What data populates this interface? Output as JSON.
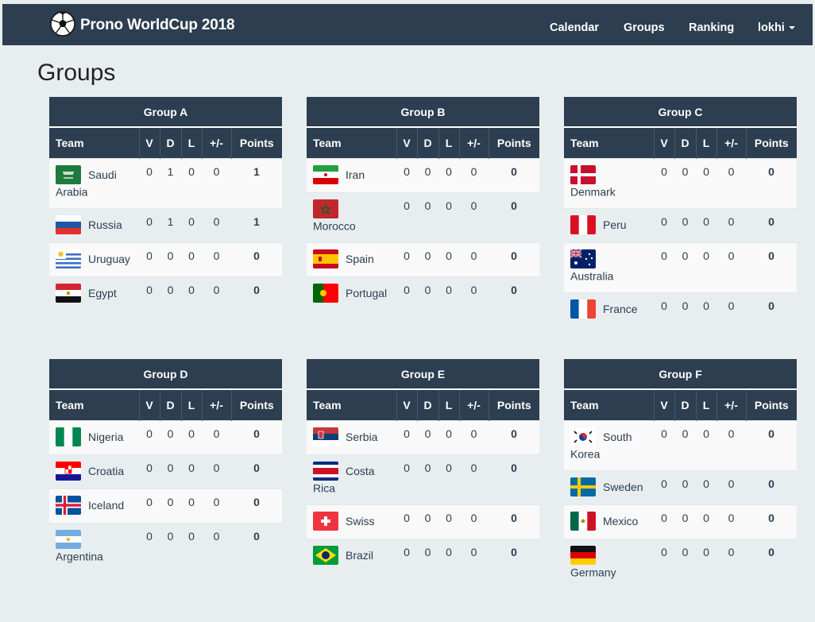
{
  "navbar": {
    "brand": "Prono WorldCup 2018",
    "links": [
      "Calendar",
      "Groups",
      "Ranking"
    ],
    "user": "lokhi"
  },
  "page": {
    "title": "Groups"
  },
  "columns": {
    "team": "Team",
    "v": "V",
    "d": "D",
    "l": "L",
    "diff": "+/-",
    "points": "Points"
  },
  "groups": [
    {
      "name": "Group A",
      "teams": [
        {
          "name": "Saudi Arabia",
          "v": "0",
          "d": "1",
          "l": "0",
          "diff": "0",
          "points": "1",
          "flag": "saudi-arabia"
        },
        {
          "name": "Russia",
          "v": "0",
          "d": "1",
          "l": "0",
          "diff": "0",
          "points": "1",
          "flag": "russia"
        },
        {
          "name": "Uruguay",
          "v": "0",
          "d": "0",
          "l": "0",
          "diff": "0",
          "points": "0",
          "flag": "uruguay"
        },
        {
          "name": "Egypt",
          "v": "0",
          "d": "0",
          "l": "0",
          "diff": "0",
          "points": "0",
          "flag": "egypt"
        }
      ]
    },
    {
      "name": "Group B",
      "teams": [
        {
          "name": "Iran",
          "v": "0",
          "d": "0",
          "l": "0",
          "diff": "0",
          "points": "0",
          "flag": "iran"
        },
        {
          "name": "Morocco",
          "v": "0",
          "d": "0",
          "l": "0",
          "diff": "0",
          "points": "0",
          "flag": "morocco"
        },
        {
          "name": "Spain",
          "v": "0",
          "d": "0",
          "l": "0",
          "diff": "0",
          "points": "0",
          "flag": "spain"
        },
        {
          "name": "Portugal",
          "v": "0",
          "d": "0",
          "l": "0",
          "diff": "0",
          "points": "0",
          "flag": "portugal"
        }
      ]
    },
    {
      "name": "Group C",
      "teams": [
        {
          "name": "Denmark",
          "v": "0",
          "d": "0",
          "l": "0",
          "diff": "0",
          "points": "0",
          "flag": "denmark"
        },
        {
          "name": "Peru",
          "v": "0",
          "d": "0",
          "l": "0",
          "diff": "0",
          "points": "0",
          "flag": "peru"
        },
        {
          "name": "Australia",
          "v": "0",
          "d": "0",
          "l": "0",
          "diff": "0",
          "points": "0",
          "flag": "australia"
        },
        {
          "name": "France",
          "v": "0",
          "d": "0",
          "l": "0",
          "diff": "0",
          "points": "0",
          "flag": "france"
        }
      ]
    },
    {
      "name": "Group D",
      "teams": [
        {
          "name": "Nigeria",
          "v": "0",
          "d": "0",
          "l": "0",
          "diff": "0",
          "points": "0",
          "flag": "nigeria"
        },
        {
          "name": "Croatia",
          "v": "0",
          "d": "0",
          "l": "0",
          "diff": "0",
          "points": "0",
          "flag": "croatia"
        },
        {
          "name": "Iceland",
          "v": "0",
          "d": "0",
          "l": "0",
          "diff": "0",
          "points": "0",
          "flag": "iceland"
        },
        {
          "name": "Argentina",
          "v": "0",
          "d": "0",
          "l": "0",
          "diff": "0",
          "points": "0",
          "flag": "argentina"
        }
      ]
    },
    {
      "name": "Group E",
      "teams": [
        {
          "name": "Serbia",
          "v": "0",
          "d": "0",
          "l": "0",
          "diff": "0",
          "points": "0",
          "flag": "serbia"
        },
        {
          "name": "Costa Rica",
          "v": "0",
          "d": "0",
          "l": "0",
          "diff": "0",
          "points": "0",
          "flag": "costa-rica"
        },
        {
          "name": "Swiss",
          "v": "0",
          "d": "0",
          "l": "0",
          "diff": "0",
          "points": "0",
          "flag": "swiss"
        },
        {
          "name": "Brazil",
          "v": "0",
          "d": "0",
          "l": "0",
          "diff": "0",
          "points": "0",
          "flag": "brazil"
        }
      ]
    },
    {
      "name": "Group F",
      "teams": [
        {
          "name": "South Korea",
          "v": "0",
          "d": "0",
          "l": "0",
          "diff": "0",
          "points": "0",
          "flag": "south-korea"
        },
        {
          "name": "Sweden",
          "v": "0",
          "d": "0",
          "l": "0",
          "diff": "0",
          "points": "0",
          "flag": "sweden"
        },
        {
          "name": "Mexico",
          "v": "0",
          "d": "0",
          "l": "0",
          "diff": "0",
          "points": "0",
          "flag": "mexico"
        },
        {
          "name": "Germany",
          "v": "0",
          "d": "0",
          "l": "0",
          "diff": "0",
          "points": "0",
          "flag": "germany"
        }
      ]
    }
  ]
}
